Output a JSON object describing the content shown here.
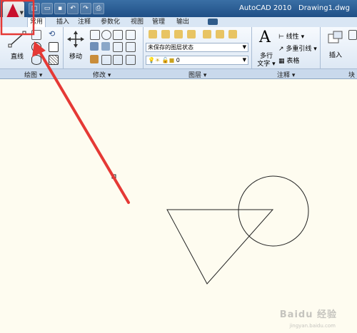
{
  "titlebar": {
    "app_title": "AutoCAD 2010",
    "document": "Drawing1.dwg",
    "qat_icons": [
      "new-icon",
      "open-icon",
      "save-icon",
      "undo-icon",
      "redo-icon",
      "plot-icon"
    ]
  },
  "tabs": [
    "常用",
    "插入",
    "注释",
    "参数化",
    "视图",
    "管理",
    "输出"
  ],
  "active_tab": "常用",
  "ribbon": {
    "draw": {
      "line_label": "直线",
      "panel_label": "绘图 ▾"
    },
    "modify": {
      "move_label": "移动",
      "panel_label": "修改 ▾"
    },
    "layers": {
      "state_value": "未保存的图层状态",
      "layer_value": "0",
      "panel_label": "图层 ▾"
    },
    "annotation": {
      "text_label": "多行\n文字",
      "text_label_line1": "多行",
      "text_label_line2": "文字 ▾",
      "linear_label": "线性 ▾",
      "multileader_label": "多重引线 ▾",
      "table_label": "表格",
      "panel_label": "注释 ▾"
    },
    "block": {
      "insert_label": "插入",
      "panel_label": "块"
    }
  },
  "canvas": {
    "background": "#fefcf0"
  },
  "annotation_overlay": {
    "highlight_color": "#e53935"
  },
  "watermark": {
    "text": "Baidu 经验",
    "sub": "jingyan.baidu.com"
  }
}
